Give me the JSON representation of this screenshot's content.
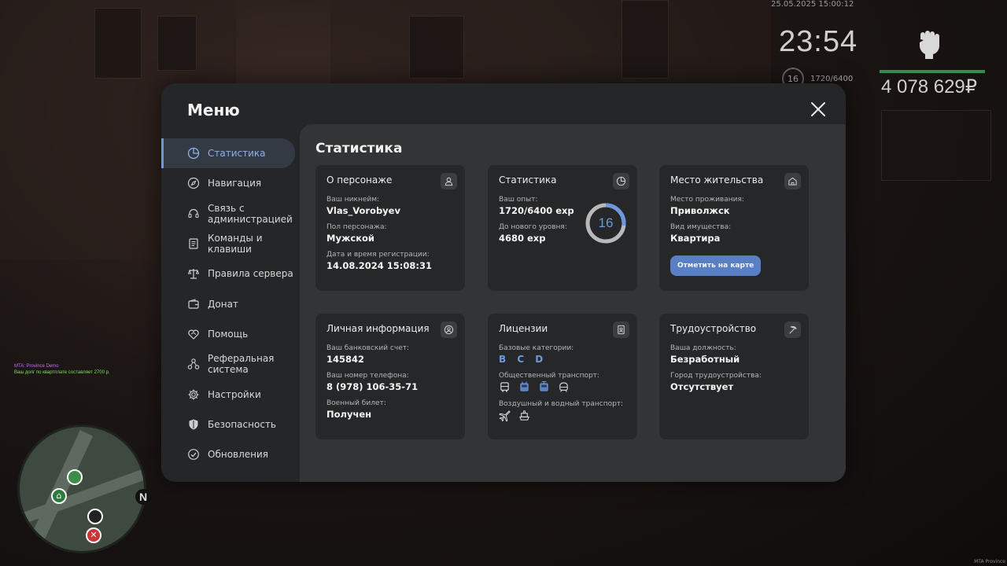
{
  "hud": {
    "datetime": "25.05.2025 15:00:12",
    "clock": "23:54",
    "level": "16",
    "exp": "1720/6400",
    "money": "4 078 629₽"
  },
  "chat": {
    "line1": "MTA: Province Demo",
    "line2": "Ваш долг по квартплате составляет 2700 р."
  },
  "minimap": {
    "north": "N"
  },
  "watermark": "MTA Province",
  "modal": {
    "title": "Меню"
  },
  "sidebar": {
    "items": [
      {
        "label": "Статистика",
        "icon": "chart-pie-icon"
      },
      {
        "label": "Навигация",
        "icon": "compass-icon"
      },
      {
        "label": "Связь с администрацией",
        "icon": "headset-icon"
      },
      {
        "label": "Команды и клавиши",
        "icon": "document-icon"
      },
      {
        "label": "Правила сервера",
        "icon": "scales-icon"
      },
      {
        "label": "Донат",
        "icon": "wallet-icon"
      },
      {
        "label": "Помощь",
        "icon": "heart-handshake-icon"
      },
      {
        "label": "Реферальная система",
        "icon": "network-icon"
      },
      {
        "label": "Настройки",
        "icon": "gear-icon"
      },
      {
        "label": "Безопасность",
        "icon": "shield-icon"
      },
      {
        "label": "Обновления",
        "icon": "check-circle-icon"
      }
    ]
  },
  "content": {
    "title": "Статистика",
    "character": {
      "title": "О персонаже",
      "nickname_label": "Ваш никнейм:",
      "nickname": "Vlas_Vorobyev",
      "gender_label": "Пол персонажа:",
      "gender": "Мужской",
      "reg_label": "Дата и время регистрации:",
      "reg": "14.08.2024 15:08:31"
    },
    "stats": {
      "title": "Статистика",
      "exp_label": "Ваш опыт:",
      "exp": "1720/6400 exp",
      "next_label": "До нового уровня:",
      "next": "4680 exp",
      "level": "16",
      "progress": 0.27
    },
    "residence": {
      "title": "Место жительства",
      "place_label": "Место проживания:",
      "place": "Приволжск",
      "type_label": "Вид имущества:",
      "type": "Квартира",
      "button": "Отметить на карте"
    },
    "personal": {
      "title": "Личная информация",
      "bank_label": "Ваш банковский счет:",
      "bank": "145842",
      "phone_label": "Ваш номер телефона:",
      "phone": "8 (978) 106-35-71",
      "military_label": "Военный билет:",
      "military": "Получен"
    },
    "licenses": {
      "title": "Лицензии",
      "base_label": "Базовые категории:",
      "base": "B C D",
      "public_label": "Общественный транспорт:",
      "air_label": "Воздушный и водный транспорт:"
    },
    "employment": {
      "title": "Трудоустройство",
      "position_label": "Ваша должность:",
      "position": "Безработный",
      "city_label": "Город трудоустройства:",
      "city": "Отсутствует"
    }
  },
  "colors": {
    "accent": "#6e97dd",
    "panel": "#252627",
    "card": "#262728"
  }
}
